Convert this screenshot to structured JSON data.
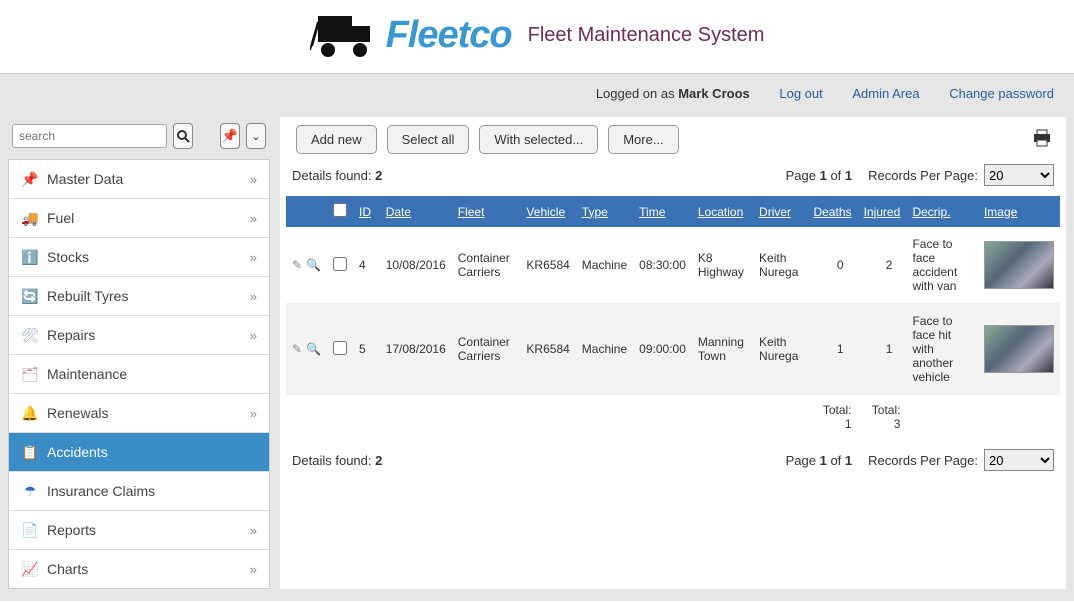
{
  "brand": {
    "name": "Fleetco",
    "subtitle": "Fleet Maintenance System"
  },
  "topbar": {
    "logged_prefix": "Logged on as ",
    "username": "Mark Croos",
    "logout": "Log out",
    "admin": "Admin Area",
    "changepw": "Change password"
  },
  "search": {
    "placeholder": "search"
  },
  "sidebar": {
    "items": [
      {
        "icon": "📌",
        "color": "#6b3",
        "label": "Master Data",
        "expandable": true
      },
      {
        "icon": "🚚",
        "color": "#e9a23b",
        "label": "Fuel",
        "expandable": true
      },
      {
        "icon": "ℹ️",
        "color": "#2a8",
        "label": "Stocks",
        "expandable": true
      },
      {
        "icon": "🔄",
        "color": "#4aa",
        "label": "Rebuilt Tyres",
        "expandable": true
      },
      {
        "icon": "🛠",
        "color": "#9ac",
        "label": "Repairs",
        "expandable": true
      },
      {
        "icon": "🗂",
        "color": "#c99",
        "label": "Maintenance",
        "expandable": false
      },
      {
        "icon": "🔔",
        "color": "#e33",
        "label": "Renewals",
        "expandable": true
      },
      {
        "icon": "📋",
        "color": "#557",
        "label": "Accidents",
        "expandable": false,
        "active": true
      },
      {
        "icon": "☂",
        "color": "#36c",
        "label": "Insurance Claims",
        "expandable": false
      },
      {
        "icon": "📄",
        "color": "#36c",
        "label": "Reports",
        "expandable": true
      },
      {
        "icon": "📈",
        "color": "#d33",
        "label": "Charts",
        "expandable": true
      }
    ]
  },
  "toolbar": {
    "add": "Add new",
    "select_all": "Select all",
    "with_selected": "With selected...",
    "more": "More..."
  },
  "details": {
    "label": "Details found: ",
    "count": "2",
    "page_prefix": "Page ",
    "page_cur": "1",
    "page_of": " of ",
    "page_total": "1",
    "rpp_label": "Records Per Page:",
    "rpp_value": "20"
  },
  "columns": [
    "ID",
    "Date",
    "Fleet",
    "Vehicle",
    "Type",
    "Time",
    "Location",
    "Driver",
    "Deaths",
    "Injured",
    "Decrip.",
    "Image"
  ],
  "rows": [
    {
      "id": "4",
      "date": "10/08/2016",
      "fleet": "Container Carriers",
      "vehicle": "KR6584",
      "type": "Machine",
      "time": "08:30:00",
      "location": "K8 Highway",
      "driver": "Keith Nurega",
      "deaths": "0",
      "injured": "2",
      "descrip": "Face to face accident with van"
    },
    {
      "id": "5",
      "date": "17/08/2016",
      "fleet": "Container Carriers",
      "vehicle": "KR6584",
      "type": "Machine",
      "time": "09:00:00",
      "location": "Manning Town",
      "driver": "Keith Nurega",
      "deaths": "1",
      "injured": "1",
      "descrip": "Face to face hit with another vehicle"
    }
  ],
  "totals": {
    "deaths_label": "Total: ",
    "deaths": "1",
    "injured_label": "Total: ",
    "injured": "3"
  }
}
